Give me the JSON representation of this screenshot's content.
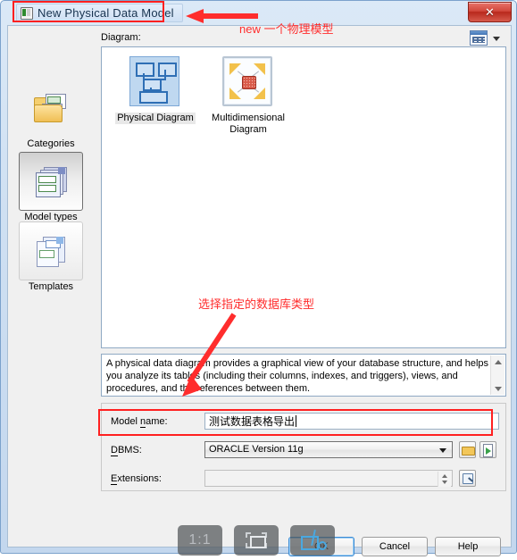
{
  "window": {
    "title": "New Physical Data Model",
    "close_label": "✕",
    "app_icon": "app-icon"
  },
  "sidebar": {
    "items": [
      {
        "label": "Categories",
        "icon": "folder-documents-icon",
        "state": "normal"
      },
      {
        "label": "Model types",
        "icon": "model-stack-icon",
        "state": "selected"
      },
      {
        "label": "Templates",
        "icon": "templates-icon",
        "state": "framed"
      }
    ]
  },
  "gallery": {
    "section_label": "Diagram:",
    "view_mode_icon": "grid-view-icon",
    "view_mode_caret": "chevron-down-icon",
    "items": [
      {
        "label": "Physical Diagram",
        "icon": "physical-diagram-icon",
        "selected": true
      },
      {
        "label": "Multidimensional Diagram",
        "icon": "multidimensional-diagram-icon",
        "selected": false
      }
    ]
  },
  "description": {
    "text": "A physical data diagram provides a graphical view of your database structure, and helps you analyze its tables (including their columns, indexes, and triggers), views, and procedures, and the references between them.",
    "scroll_up_icon": "scroll-up-arrow-icon",
    "scroll_down_icon": "scroll-down-arrow-icon"
  },
  "form": {
    "model_name": {
      "label": "Model name:",
      "label_mnemonic": "n",
      "value": "测试数据表格导出"
    },
    "dbms": {
      "label": "DBMS:",
      "label_mnemonic": "D",
      "value": "ORACLE Version 11g",
      "caret_icon": "chevron-down-icon",
      "browse_icon": "folder-open-icon",
      "import_icon": "import-green-arrow-icon"
    },
    "extensions": {
      "label": "Extensions:",
      "label_mnemonic": "E",
      "value": "",
      "spinner_icon": "spinner-updown-icon",
      "browse_icon": "magnifier-icon"
    }
  },
  "buttons": {
    "ok": "OK",
    "cancel": "Cancel",
    "help": "Help"
  },
  "annotations": {
    "top_note": "new 一个物理模型",
    "dbms_note": "选择指定的数据库类型",
    "color": "#ff2d2d",
    "title_highlight_box": "red-rectangle-around-title",
    "dbms_highlight_box": "red-rectangle-around-dbms-row",
    "arrow_to_title": "red-arrow-left",
    "arrow_to_dbms": "red-arrow-down-left"
  },
  "capture_toolbar": {
    "scale_label": "1:1",
    "fullscreen_icon": "fit-to-screen-icon",
    "crop_icon": "crop-scissors-icon"
  }
}
